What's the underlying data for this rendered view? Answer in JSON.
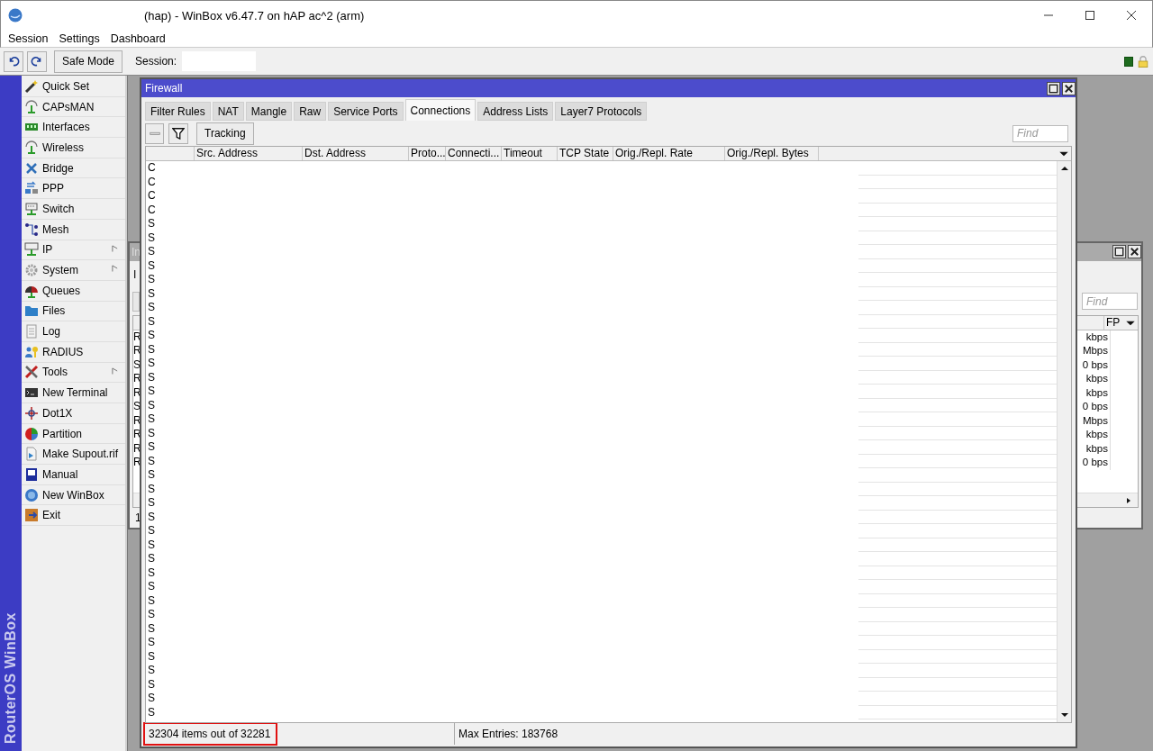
{
  "window": {
    "title": "(hap) - WinBox v6.47.7 on hAP ac^2 (arm)"
  },
  "menu_bar": [
    "Session",
    "Settings",
    "Dashboard"
  ],
  "toolbar": {
    "safe_mode": "Safe Mode",
    "session_label": "Session:"
  },
  "sidebar": {
    "brand": "RouterOS WinBox",
    "items": [
      {
        "label": "Quick Set",
        "submenu": false
      },
      {
        "label": "CAPsMAN",
        "submenu": false
      },
      {
        "label": "Interfaces",
        "submenu": false
      },
      {
        "label": "Wireless",
        "submenu": false
      },
      {
        "label": "Bridge",
        "submenu": false
      },
      {
        "label": "PPP",
        "submenu": false
      },
      {
        "label": "Switch",
        "submenu": false
      },
      {
        "label": "Mesh",
        "submenu": false
      },
      {
        "label": "IP",
        "submenu": true
      },
      {
        "label": "System",
        "submenu": true
      },
      {
        "label": "Queues",
        "submenu": false
      },
      {
        "label": "Files",
        "submenu": false
      },
      {
        "label": "Log",
        "submenu": false
      },
      {
        "label": "RADIUS",
        "submenu": false
      },
      {
        "label": "Tools",
        "submenu": true
      },
      {
        "label": "New Terminal",
        "submenu": false
      },
      {
        "label": "Dot1X",
        "submenu": false
      },
      {
        "label": "Partition",
        "submenu": false
      },
      {
        "label": "Make Supout.rif",
        "submenu": false
      },
      {
        "label": "Manual",
        "submenu": false
      },
      {
        "label": "New WinBox",
        "submenu": false
      },
      {
        "label": "Exit",
        "submenu": false
      }
    ]
  },
  "back_window": {
    "title": "In",
    "tab": "I",
    "find_placeholder": "Find",
    "column_header": "FP",
    "status": "1",
    "rows": [
      {
        "column_1": "R",
        "column_2": "kbps"
      },
      {
        "column_1": "R",
        "column_2": "Mbps"
      },
      {
        "column_1": "S",
        "column_2": "0 bps"
      },
      {
        "column_1": "R",
        "column_2": "kbps"
      },
      {
        "column_1": "R",
        "column_2": "kbps"
      },
      {
        "column_1": "S",
        "column_2": "0 bps"
      },
      {
        "column_1": "R",
        "column_2": "Mbps"
      },
      {
        "column_1": "R",
        "column_2": "kbps"
      },
      {
        "column_1": "R",
        "column_2": "kbps"
      },
      {
        "column_1": "R",
        "column_2": "0 bps"
      }
    ]
  },
  "firewall": {
    "title": "Firewall",
    "tabs": [
      {
        "label": "Filter Rules",
        "selected": false
      },
      {
        "label": "NAT",
        "selected": false
      },
      {
        "label": "Mangle",
        "selected": false
      },
      {
        "label": "Raw",
        "selected": false
      },
      {
        "label": "Service Ports",
        "selected": false
      },
      {
        "label": "Connections",
        "selected": true
      },
      {
        "label": "Address Lists",
        "selected": false
      },
      {
        "label": "Layer7 Protocols",
        "selected": false
      }
    ],
    "toolbar_button": "Tracking",
    "find_placeholder": "Find",
    "columns": [
      "Src. Address",
      "Dst. Address",
      "Proto...",
      "Connecti...",
      "Timeout",
      "TCP State",
      "Orig./Repl. Rate",
      "Orig./Repl. Bytes"
    ],
    "rows": [
      "C",
      "C",
      "C",
      "C",
      "S",
      "S",
      "S",
      "S",
      "S",
      "S",
      "S",
      "S",
      "S",
      "S",
      "S",
      "S",
      "S",
      "S",
      "S",
      "S",
      "S",
      "S",
      "S",
      "S",
      "S",
      "S",
      "S",
      "S",
      "S",
      "S",
      "S",
      "S",
      "S",
      "S",
      "S",
      "S",
      "S",
      "S",
      "S",
      "S"
    ],
    "status": [
      {
        "text": "32304 items out of 32281",
        "highlighted": true
      },
      {
        "text": "Max Entries: 183768",
        "highlighted": false
      }
    ]
  }
}
